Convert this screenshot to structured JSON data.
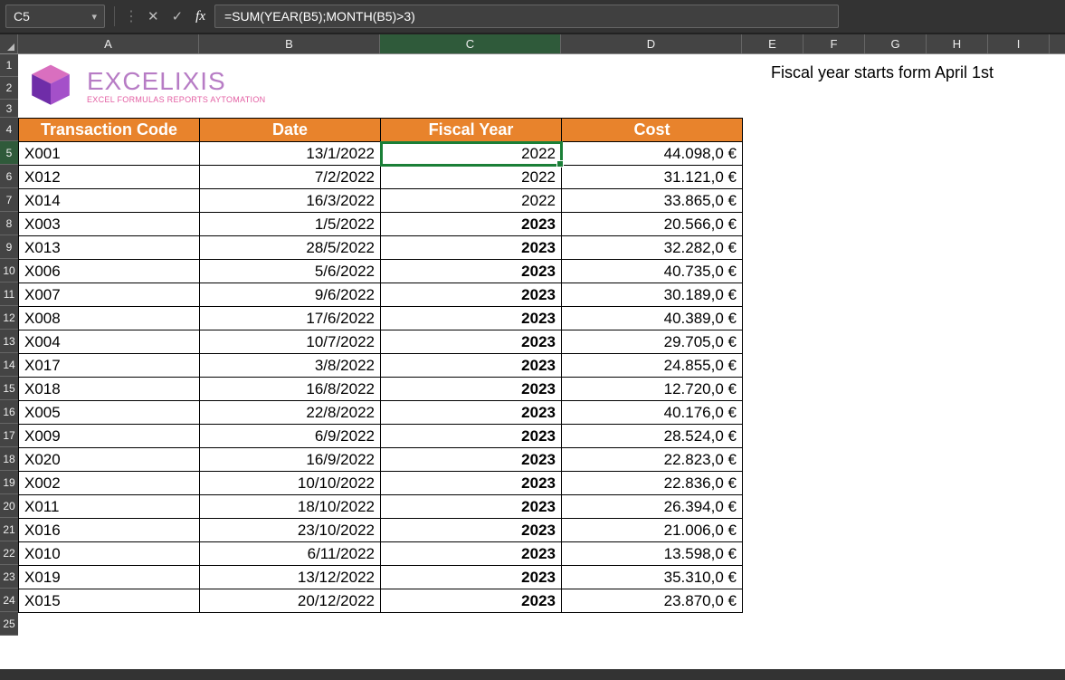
{
  "formula_bar": {
    "cell_ref": "C5",
    "cancel": "✕",
    "enter": "✓",
    "fx": "fx",
    "formula": "=SUM(YEAR(B5);MONTH(B5)>3)"
  },
  "columns": [
    "A",
    "B",
    "C",
    "D",
    "E",
    "F",
    "G",
    "H",
    "I"
  ],
  "row_numbers": [
    "1",
    "2",
    "3",
    "4",
    "5",
    "6",
    "7",
    "8",
    "9",
    "10",
    "11",
    "12",
    "13",
    "14",
    "15",
    "16",
    "17",
    "18",
    "19",
    "20",
    "21",
    "22",
    "23",
    "24",
    "25"
  ],
  "logo": {
    "brand": "EXCELIXIS",
    "tagline": "EXCEL FORMULAS REPORTS AYTOMATION"
  },
  "table": {
    "headers": {
      "code": "Transaction Code",
      "date": "Date",
      "fy": "Fiscal Year",
      "cost": "Cost"
    },
    "rows": [
      {
        "code": "X001",
        "date": "13/1/2022",
        "fy": "2022",
        "cost": "44.098,0 €",
        "bold": false
      },
      {
        "code": "X012",
        "date": "7/2/2022",
        "fy": "2022",
        "cost": "31.121,0 €",
        "bold": false
      },
      {
        "code": "X014",
        "date": "16/3/2022",
        "fy": "2022",
        "cost": "33.865,0 €",
        "bold": false
      },
      {
        "code": "X003",
        "date": "1/5/2022",
        "fy": "2023",
        "cost": "20.566,0 €",
        "bold": true
      },
      {
        "code": "X013",
        "date": "28/5/2022",
        "fy": "2023",
        "cost": "32.282,0 €",
        "bold": true
      },
      {
        "code": "X006",
        "date": "5/6/2022",
        "fy": "2023",
        "cost": "40.735,0 €",
        "bold": true
      },
      {
        "code": "X007",
        "date": "9/6/2022",
        "fy": "2023",
        "cost": "30.189,0 €",
        "bold": true
      },
      {
        "code": "X008",
        "date": "17/6/2022",
        "fy": "2023",
        "cost": "40.389,0 €",
        "bold": true
      },
      {
        "code": "X004",
        "date": "10/7/2022",
        "fy": "2023",
        "cost": "29.705,0 €",
        "bold": true
      },
      {
        "code": "X017",
        "date": "3/8/2022",
        "fy": "2023",
        "cost": "24.855,0 €",
        "bold": true
      },
      {
        "code": "X018",
        "date": "16/8/2022",
        "fy": "2023",
        "cost": "12.720,0 €",
        "bold": true
      },
      {
        "code": "X005",
        "date": "22/8/2022",
        "fy": "2023",
        "cost": "40.176,0 €",
        "bold": true
      },
      {
        "code": "X009",
        "date": "6/9/2022",
        "fy": "2023",
        "cost": "28.524,0 €",
        "bold": true
      },
      {
        "code": "X020",
        "date": "16/9/2022",
        "fy": "2023",
        "cost": "22.823,0 €",
        "bold": true
      },
      {
        "code": "X002",
        "date": "10/10/2022",
        "fy": "2023",
        "cost": "22.836,0 €",
        "bold": true
      },
      {
        "code": "X011",
        "date": "18/10/2022",
        "fy": "2023",
        "cost": "26.394,0 €",
        "bold": true
      },
      {
        "code": "X016",
        "date": "23/10/2022",
        "fy": "2023",
        "cost": "21.006,0 €",
        "bold": true
      },
      {
        "code": "X010",
        "date": "6/11/2022",
        "fy": "2023",
        "cost": "13.598,0 €",
        "bold": true
      },
      {
        "code": "X019",
        "date": "13/12/2022",
        "fy": "2023",
        "cost": "35.310,0 €",
        "bold": true
      },
      {
        "code": "X015",
        "date": "20/12/2022",
        "fy": "2023",
        "cost": "23.870,0 €",
        "bold": true
      }
    ]
  },
  "side_note": "Fiscal year starts form April 1st"
}
